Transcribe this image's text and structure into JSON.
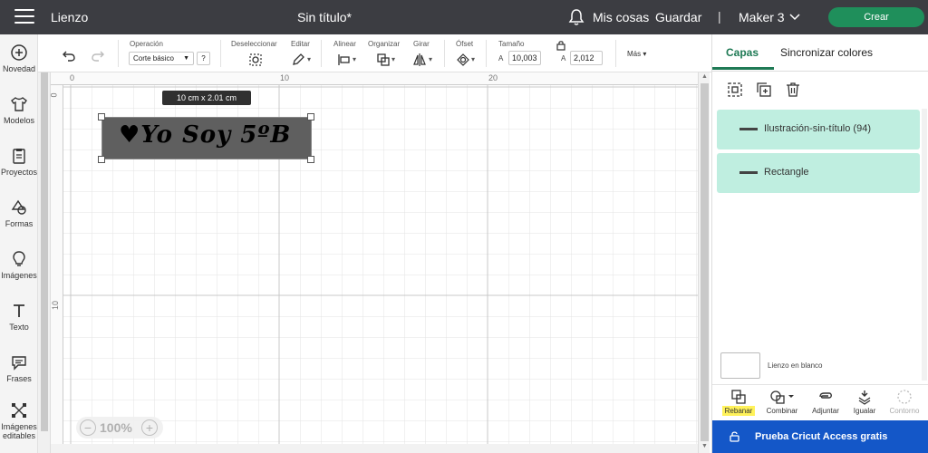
{
  "topbar": {
    "app_title": "Lienzo",
    "doc_title": "Sin título*",
    "my_stuff": "Mis cosas",
    "save": "Guardar",
    "separator": "|",
    "machine": "Maker 3",
    "create": "Crear"
  },
  "sidebar": {
    "items": [
      {
        "label": "Novedad",
        "icon": "plus-circle-icon"
      },
      {
        "label": "Modelos",
        "icon": "shirt-icon"
      },
      {
        "label": "Proyectos",
        "icon": "clipboard-icon"
      },
      {
        "label": "Formas",
        "icon": "shapes-icon"
      },
      {
        "label": "Imágenes",
        "icon": "lightbulb-icon"
      },
      {
        "label": "Texto",
        "icon": "text-icon"
      },
      {
        "label": "Frases",
        "icon": "speech-bubble-icon"
      },
      {
        "label": "Imágenes editables",
        "icon": "edit-nodes-icon"
      }
    ]
  },
  "toolbar": {
    "operation_label": "Operación",
    "operation_value": "Corte básico",
    "help": "?",
    "deselect_label": "Deseleccionar",
    "edit_label": "Editar",
    "align_label": "Alinear",
    "organize_label": "Organizar",
    "rotate_label": "Girar",
    "offset_label": "Ófset",
    "size_label": "Tamaño",
    "width_letter": "A",
    "width_value": "10,003",
    "height_letter": "A",
    "height_value": "2,012",
    "more_label": "Más"
  },
  "rulers": {
    "h_ticks": [
      "0",
      "10",
      "20"
    ],
    "v_ticks": [
      "0",
      "10"
    ]
  },
  "canvas": {
    "dimension_tooltip": "10  cm x 2.01  cm",
    "design_text": "♥Yo Soy 5ºB",
    "zoom": "100%",
    "zoom_minus": "−",
    "zoom_plus": "+"
  },
  "right_panel": {
    "tabs": [
      "Capas",
      "Sincronizar colores"
    ],
    "layers": [
      {
        "name": "Ilustración-sin-título (94)"
      },
      {
        "name": "Rectangle"
      }
    ],
    "blank_canvas": "Lienzo en blanco",
    "tools": [
      {
        "label": "Rebanar",
        "icon": "slice-icon",
        "highlight": true
      },
      {
        "label": "Combinar",
        "icon": "combine-icon"
      },
      {
        "label": "Adjuntar",
        "icon": "attach-icon"
      },
      {
        "label": "Igualar",
        "icon": "flatten-icon"
      },
      {
        "label": "Contorno",
        "icon": "contour-icon",
        "disabled": true
      }
    ],
    "promo": "Prueba Cricut Access gratis"
  },
  "colors": {
    "topbar": "#3c3d42",
    "create_button": "#1f8f5b",
    "active_tab": "#1f7a55",
    "layer_bg": "#bfeee0",
    "promo_bg": "#1457c8",
    "highlight": "#fff25a"
  }
}
